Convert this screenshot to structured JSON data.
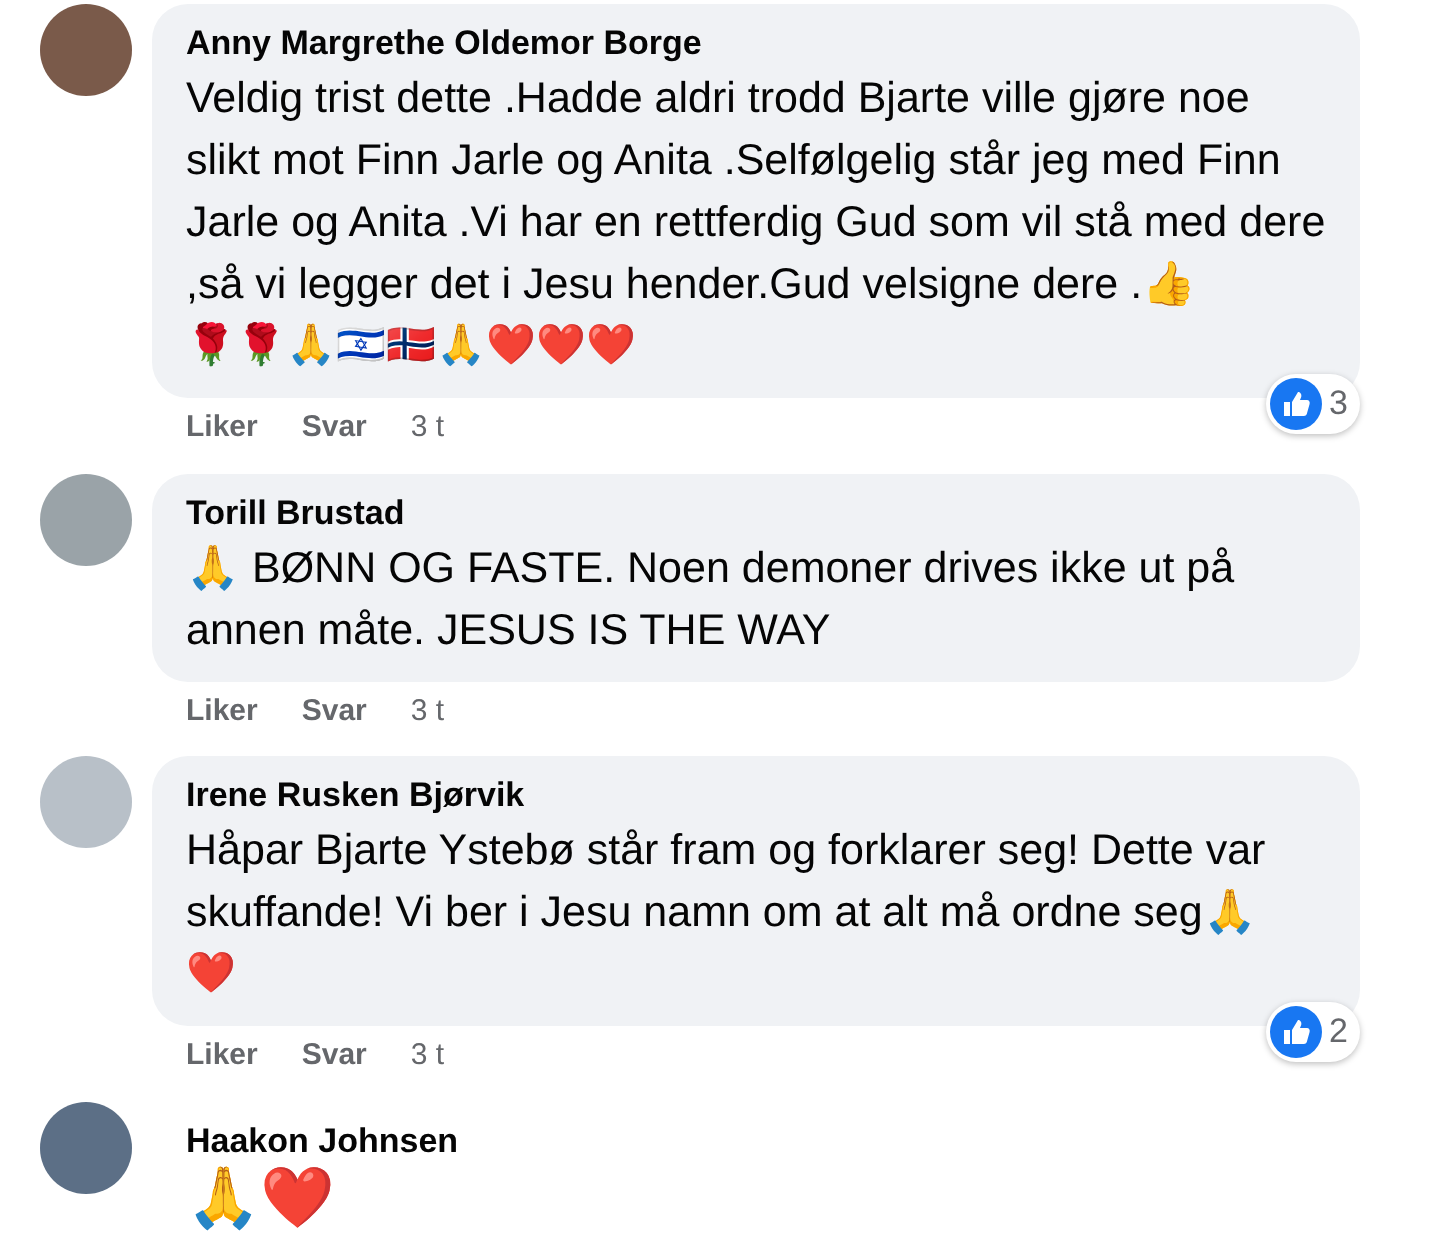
{
  "comments": [
    {
      "kind": "text",
      "author": "Anny Margrethe Oldemor Borge",
      "text": "Veldig trist dette .Hadde aldri trodd Bjarte ville gjøre noe slikt mot Finn Jarle og Anita .Selfølgelig står jeg med Finn Jarle og Anita .Vi har en rettferdig Gud som vil stå med dere ,så vi legger det i Jesu hender.Gud velsigne dere .👍",
      "extra": "🌹🌹🙏🇮🇱🇳🇴🙏❤️❤️❤️",
      "reactions": "3",
      "actions": [
        "Liker",
        "Svar"
      ],
      "time": "3 t"
    },
    {
      "kind": "text",
      "author": "Torill Brustad",
      "text": "🙏 BØNN OG FASTE. Noen demoner drives ikke ut på annen måte. JESUS IS THE WAY",
      "actions": [
        "Liker",
        "Svar"
      ],
      "time": "3 t"
    },
    {
      "kind": "text",
      "author": "Irene Rusken Bjørvik",
      "text": "Håpar Bjarte Ystebø står fram og forklarer seg! Dette var skuffande! Vi ber i Jesu namn om at alt må ordne seg🙏",
      "extra": "❤️",
      "reactions": "2",
      "actions": [
        "Liker",
        "Svar"
      ],
      "time": "3 t"
    },
    {
      "kind": "emoji",
      "author": "Haakon Johnsen",
      "text": "🙏❤️"
    }
  ]
}
